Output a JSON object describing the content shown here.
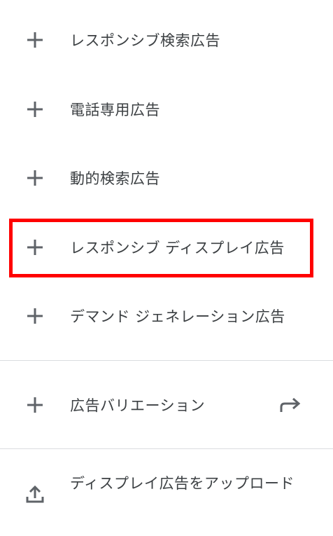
{
  "menu": {
    "items": [
      {
        "label": "レスポンシブ検索広告",
        "icon": "plus-icon"
      },
      {
        "label": "電話専用広告",
        "icon": "plus-icon"
      },
      {
        "label": "動的検索広告",
        "icon": "plus-icon"
      },
      {
        "label": "レスポンシブ ディスプレイ広告",
        "icon": "plus-icon",
        "highlighted": true
      },
      {
        "label": "デマンド ジェネレーション広告",
        "icon": "plus-icon"
      }
    ],
    "variation": {
      "label": "広告バリエーション",
      "icon": "plus-icon",
      "trailing_icon": "redo-arrow-icon"
    },
    "upload": {
      "label": "ディスプレイ広告をアップロード",
      "icon": "upload-icon"
    }
  },
  "colors": {
    "text": "#3c4043",
    "icon": "#5f6368",
    "divider": "#dadce0",
    "highlight": "#ff0000"
  }
}
